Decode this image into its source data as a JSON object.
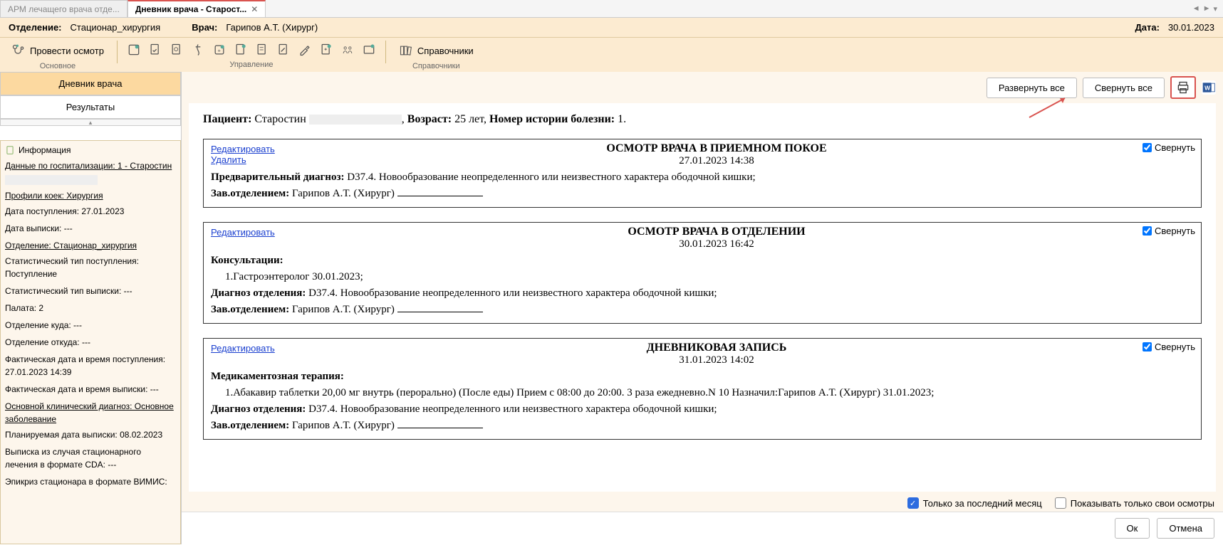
{
  "tabs": {
    "inactive": "АРМ лечащего врача отде...",
    "active": "Дневник врача - Старост..."
  },
  "header": {
    "dept_label": "Отделение:",
    "dept_value": "Стационар_хирургия",
    "doctor_label": "Врач:",
    "doctor_value": "Гарипов А.Т. (Хирург)",
    "date_label": "Дата:",
    "date_value": "30.01.2023"
  },
  "toolbar": {
    "exam_btn": "Провести осмотр",
    "group_main": "Основное",
    "group_manage": "Управление",
    "group_ref": "Справочники",
    "ref_btn": "Справочники"
  },
  "sidetabs": {
    "diary": "Дневник врача",
    "results": "Результаты"
  },
  "info": {
    "title": "Информация",
    "hosp_link": "Данные по госпитализации: 1 - Старостин",
    "profile_link": "Профили коек: Хирургия",
    "admit_date": "Дата поступления: 27.01.2023",
    "discharge_date": "Дата выписки: ---",
    "dept_link": "Отделение: Стационар_хирургия",
    "stat_in": "Статистический тип поступления: Поступление",
    "stat_out": "Статистический тип выписки: ---",
    "ward": "Палата: 2",
    "dept_to": "Отделение куда: ---",
    "dept_from": "Отделение откуда: ---",
    "fact_in": "Фактическая дата и время поступления: 27.01.2023 14:39",
    "fact_out": "Фактическая дата и время выписки: ---",
    "main_diag_link": "Основной клинический диагноз: Основное заболевание",
    "planned": "Планируемая дата выписки: 08.02.2023",
    "cda": "Выписка из случая стационарного лечения в формате CDA: ---",
    "vimis": "Эпикриз стационара в формате ВИМИС:"
  },
  "top_buttons": {
    "expand": "Развернуть все",
    "collapse": "Свернуть все"
  },
  "patient": {
    "p_label": "Пациент:",
    "p_value": "Старостин",
    "age_label": "Возраст:",
    "age_value": "25 лет,",
    "num_label": "Номер истории болезни:",
    "num_value": "1."
  },
  "records": [
    {
      "edit": "Редактировать",
      "del": "Удалить",
      "title": "ОСМОТР ВРАЧА В ПРИЕМНОМ ПОКОЕ",
      "dt": "27.01.2023 14:38",
      "rows": [
        {
          "label": "Предварительный диагноз:",
          "text": "D37.4. Новообразование неопределенного или неизвестного характера ободочной кишки;"
        },
        {
          "label": "Зав.отделением:",
          "text": "Гарипов А.Т. (Хирург)",
          "sig": true
        }
      ],
      "collapse": "Свернуть"
    },
    {
      "edit": "Редактировать",
      "title": "ОСМОТР ВРАЧА В ОТДЕЛЕНИИ",
      "dt": "30.01.2023 16:42",
      "rows": [
        {
          "label": "Консультации:",
          "list": "1.Гастроэнтеролог 30.01.2023;"
        },
        {
          "label": "Диагноз отделения:",
          "text": "D37.4. Новообразование неопределенного или неизвестного характера ободочной кишки;"
        },
        {
          "label": "Зав.отделением:",
          "text": "Гарипов А.Т. (Хирург)",
          "sig": true
        }
      ],
      "collapse": "Свернуть"
    },
    {
      "edit": "Редактировать",
      "title": "ДНЕВНИКОВАЯ ЗАПИСЬ",
      "dt": "31.01.2023 14:02",
      "rows": [
        {
          "label": "Медикаментозная терапия:",
          "list": "1.Абакавир таблетки 20,00 мг внутрь (перорально) (После еды) Прием с 08:00 до 20:00. 3 раза ежедневно.N 10 Назначил:Гарипов А.Т. (Хирург) 31.01.2023;"
        },
        {
          "label": "Диагноз отделения:",
          "text": "D37.4. Новообразование неопределенного или неизвестного характера ободочной кишки;"
        },
        {
          "label": "Зав.отделением:",
          "text": "Гарипов А.Т. (Хирург)",
          "sig": true
        }
      ],
      "collapse": "Свернуть"
    }
  ],
  "options": {
    "last_month": "Только за последний месяц",
    "own": "Показывать только свои осмотры"
  },
  "actions": {
    "ok": "Ок",
    "cancel": "Отмена"
  }
}
